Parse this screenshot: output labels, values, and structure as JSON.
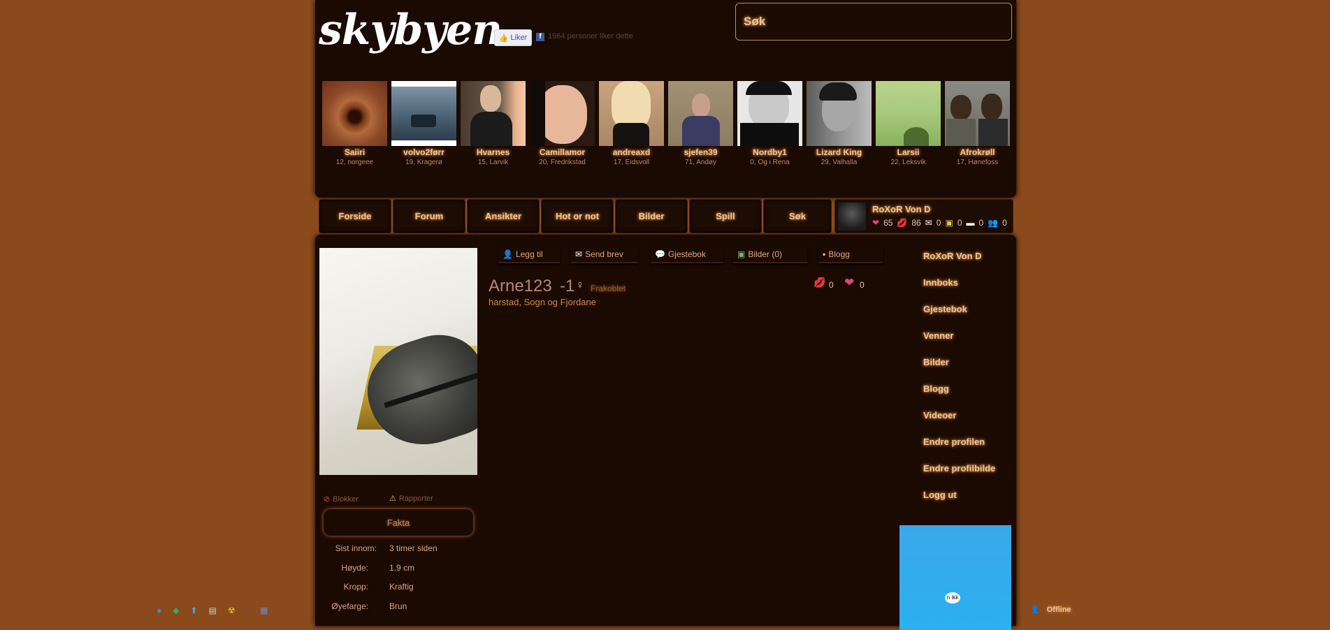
{
  "header": {
    "logo": "skybyen",
    "like_button": "Liker",
    "like_count_text": "1964 personer liker dette",
    "search_label": "Søk"
  },
  "members": [
    {
      "name": "Saiiri",
      "info": "12, norgeee"
    },
    {
      "name": "volvo2førr",
      "info": "19, Kragerø"
    },
    {
      "name": "Hvarnes",
      "info": "15, Larvik"
    },
    {
      "name": "Camillamor",
      "info": "20, Fredrikstad"
    },
    {
      "name": "andreaxd",
      "info": "17, Eidsvoll"
    },
    {
      "name": "sjefen39",
      "info": "71, Andøy"
    },
    {
      "name": "Nordby1",
      "info": "0, Og i Rena"
    },
    {
      "name": "Lizard King",
      "info": "29, Valhalla"
    },
    {
      "name": "Larsii",
      "info": "22, Leksvik"
    },
    {
      "name": "Afrokrøll",
      "info": "17, Hønefoss"
    }
  ],
  "nav": {
    "items": [
      "Forside",
      "Forum",
      "Ansikter",
      "Hot or not",
      "Bilder",
      "Spill",
      "Søk"
    ]
  },
  "user": {
    "name": "RoXoR Von D",
    "hearts": "65",
    "kisses": "86",
    "mail": "0",
    "photos": "0",
    "comments": "0",
    "friends": "0"
  },
  "profile": {
    "tabs": [
      "Legg til",
      "Send brev",
      "Gjestebok",
      "Bilder (0)",
      "Blogg"
    ],
    "username": "Arne123",
    "age": "-1",
    "status": "Frakoblet",
    "location": "harstad, Sogn og Fjordane",
    "kisses": "0",
    "hearts": "0",
    "block_label": "Blokker",
    "report_label": "Rapporter",
    "fakta_title": "Fakta",
    "fakta": [
      {
        "label": "Sist innom:",
        "value": "3 timer siden"
      },
      {
        "label": "Høyde:",
        "value": "1.9 cm"
      },
      {
        "label": "Kropp:",
        "value": "Kraftig"
      },
      {
        "label": "Øyefarge:",
        "value": "Brun"
      }
    ]
  },
  "side_menu": {
    "items": [
      "RoXoR Von D",
      "Innboks",
      "Gjestebok",
      "Venner",
      "Bilder",
      "Blogg",
      "Videoer",
      "Endre profilen",
      "Endre profilbilde",
      "Logg ut"
    ]
  },
  "footer": {
    "offline_label": "Offline",
    "ad_text": "n ikk"
  },
  "colors": {
    "background": "#8b4a1b",
    "panel": "#1a0a02",
    "accent": "#e0a878"
  }
}
